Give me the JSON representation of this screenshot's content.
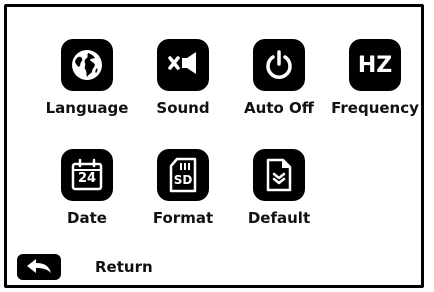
{
  "menu": {
    "items": [
      {
        "label": "Language",
        "icon": "globe-icon"
      },
      {
        "label": "Sound",
        "icon": "mute-speaker-icon"
      },
      {
        "label": "Auto Off",
        "icon": "power-icon"
      },
      {
        "label": "Frequency",
        "icon": "hz-icon",
        "icon_text": "HZ"
      },
      {
        "label": "Date",
        "icon": "calendar-icon",
        "icon_text": "24"
      },
      {
        "label": "Format",
        "icon": "sd-card-icon",
        "icon_text": "SD"
      },
      {
        "label": "Default",
        "icon": "document-check-icon"
      }
    ]
  },
  "footer": {
    "return_label": "Return",
    "return_icon": "back-arrow-icon"
  },
  "colors": {
    "icon_background": "#000000",
    "icon_foreground": "#ffffff",
    "border": "#000000"
  }
}
